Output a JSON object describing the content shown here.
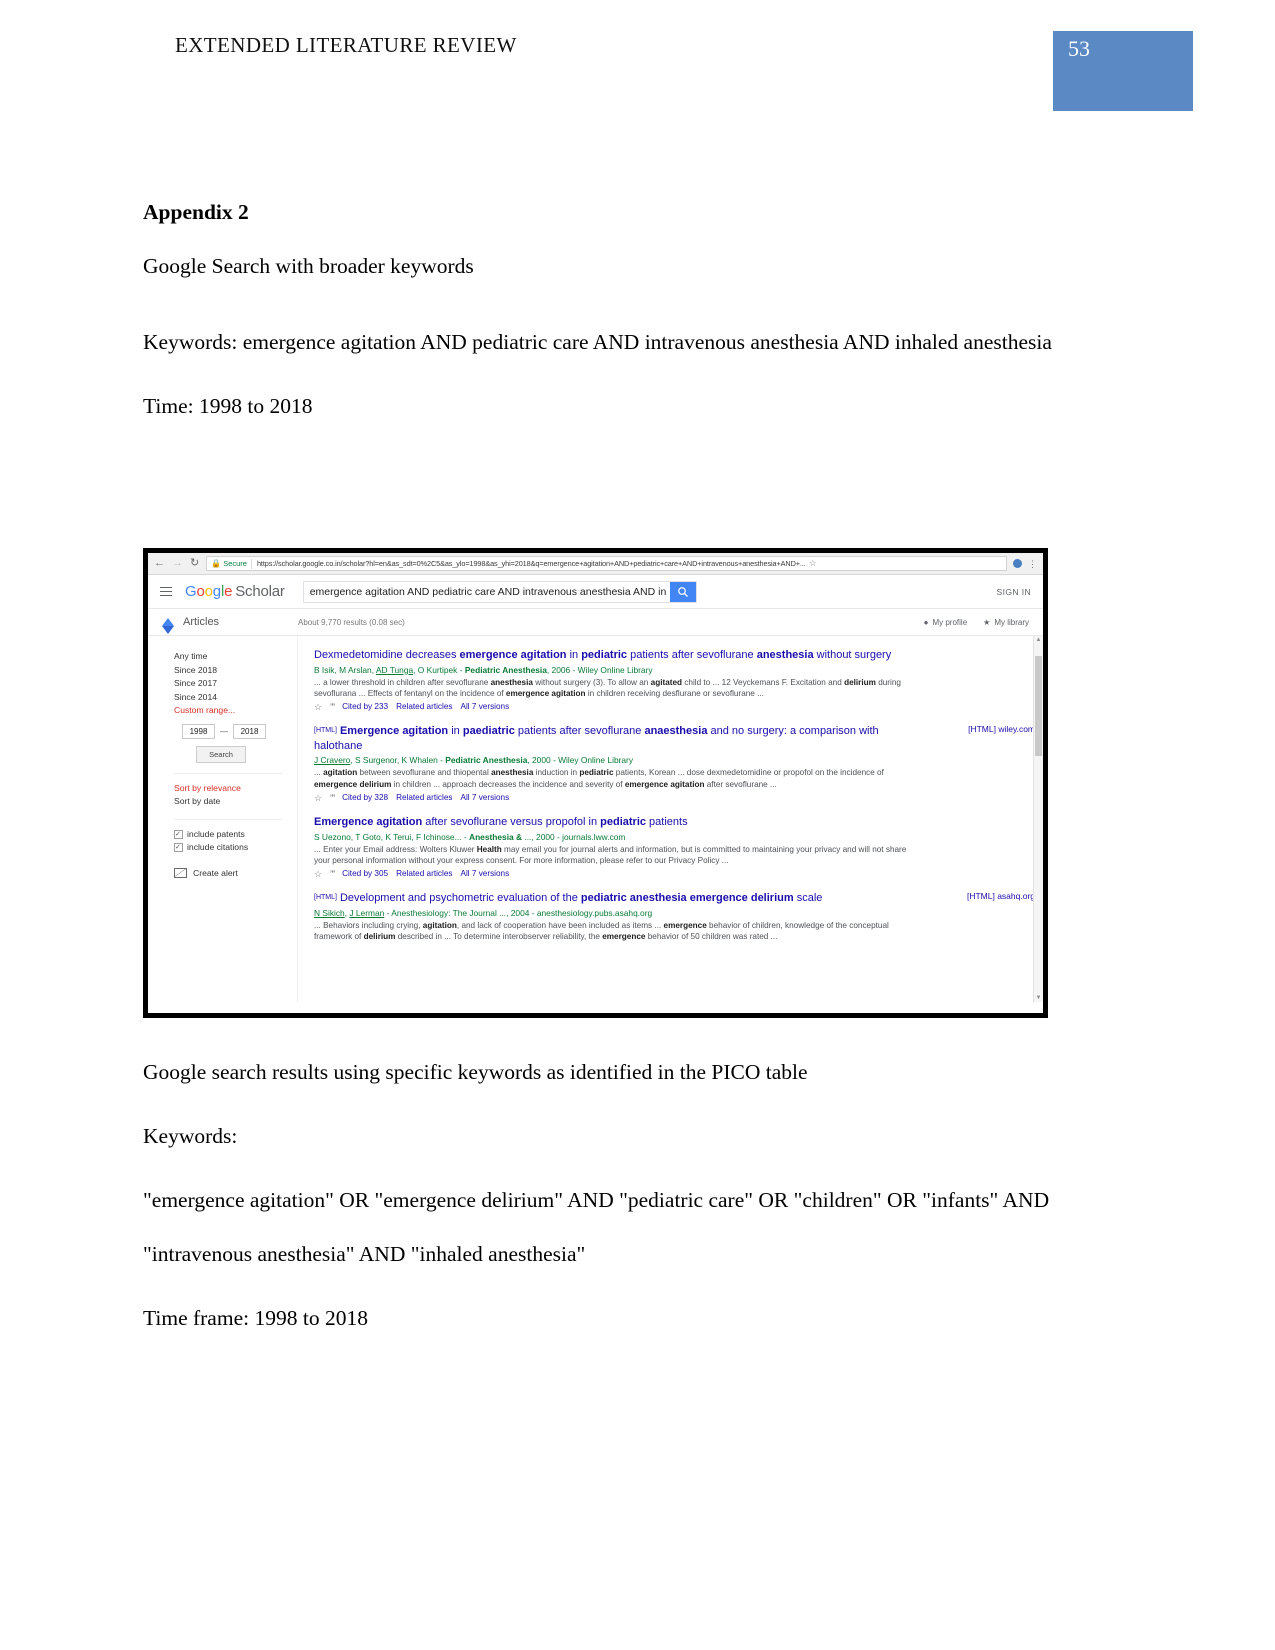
{
  "header": {
    "running_title": "EXTENDED LITERATURE REVIEW",
    "page_number": "53",
    "page_box_color": "#5b89c4"
  },
  "body_top": {
    "appendix_title": "Appendix 2",
    "subtitle": "Google Search with broader keywords",
    "keywords_line": "Keywords: emergence agitation AND pediatric care AND intravenous anesthesia AND inhaled anesthesia",
    "time_line": "Time: 1998 to 2018"
  },
  "body_bottom": {
    "caption": "Google search results using specific keywords as identified in the PICO table",
    "keywords_label": "Keywords:",
    "keywords_text": "\"emergence agitation\" OR \"emergence delirium\" AND \"pediatric care\" OR \"children\" OR \"infants\" AND \"intravenous anesthesia\" AND \"inhaled anesthesia\"",
    "time_frame": "Time frame: 1998 to 2018"
  },
  "screenshot": {
    "browser": {
      "secure_label": "Secure",
      "url": "https://scholar.google.co.in/scholar?hl=en&as_sdt=0%2C5&as_ylo=1998&as_yhi=2018&q=emergence+agitation+AND+pediatric+care+AND+intravenous+anesthesia+AND+...",
      "back_icon": "←",
      "forward_icon": "→",
      "reload_icon": "↻",
      "star_icon": "☆",
      "menu_icon": "⋮"
    },
    "scholar_header": {
      "logo_google": "Google",
      "logo_scholar": "Scholar",
      "search_value": "emergence agitation AND pediatric care AND intravenous anesthesia AND in",
      "sign_in": "SIGN IN"
    },
    "results_bar": {
      "articles_label": "Articles",
      "result_count": "About 9,770 results (0.08 sec)",
      "my_profile": "My profile",
      "my_library": "My library"
    },
    "sidebar": {
      "time_filters": [
        "Any time",
        "Since 2018",
        "Since 2017",
        "Since 2014"
      ],
      "custom_range": "Custom range...",
      "year_from": "1998",
      "year_to": "2018",
      "range_dash": "—",
      "search_button": "Search",
      "sort_options": [
        "Sort by relevance",
        "Sort by date"
      ],
      "checkboxes": [
        "include patents",
        "include citations"
      ],
      "create_alert": "Create alert"
    },
    "results": [
      {
        "title_html": "Dexmedetomidine decreases <b>emergence agitation</b> in <b>pediatric</b> patients after sevoflurane <b>anesthesia</b> without surgery",
        "tag": "",
        "authors_html": "B Isik, M Arslan, <u>AD Tunga</u>, O Kurtipek - <b>Pediatric Anesthesia</b>, 2006 - Wiley Online Library",
        "snippet_html": "... a lower threshold in children after sevoflurane <b>anesthesia</b> without surgery (3). To allow an <b>agitated</b> child to ... 12 Veyckemans F. Excitation and <b>delirium</b> during sevoflurana ... Effects of fentanyl on the incidence of <b>emergence agitation</b> in children receiving desflurane or sevoflurane ...",
        "cited_by": "Cited by 233",
        "related": "Related articles",
        "versions": "All 7 versions",
        "side_link": ""
      },
      {
        "title_html": "<b>Emergence agitation</b> in <b>paediatric</b> patients after sevoflurane <b>anaesthesia</b> and no surgery: a comparison with halothane",
        "tag": "[HTML]",
        "authors_html": "<u>J Cravero</u>, S Surgenor, K Whalen - <b>Pediatric Anesthesia</b>, 2000 - Wiley Online Library",
        "snippet_html": "... <b>agitation</b> between sevoflurane and thiopental <b>anesthesia</b> induction in <b>pediatric</b> patients, Korean ... dose dexmedetomidine or propofol on the incidence of <b>emergence delirium</b> in children ... approach decreases the incidence and severity of <b>emergence agitation</b> after sevoflurane ...",
        "cited_by": "Cited by 328",
        "related": "Related articles",
        "versions": "All 7 versions",
        "side_link": "[HTML] wiley.com"
      },
      {
        "title_html": "<b>Emergence agitation</b> after sevoflurane versus propofol in <b>pediatric</b> patients",
        "tag": "",
        "authors_html": "S Uezono, T Goto, K Terui, F Ichinose... - <b>Anesthesia &amp;</b> ..., 2000 - journals.lww.com",
        "snippet_html": "... Enter your Email address: Wolters Kluwer <b>Health</b> may email you for journal alerts and information, but is committed to maintaining your privacy and will not share your personal information without your express consent. For more information, please refer to our Privacy Policy ...",
        "cited_by": "Cited by 305",
        "related": "Related articles",
        "versions": "All 7 versions",
        "side_link": ""
      },
      {
        "title_html": "Development and psychometric evaluation of the <b>pediatric anesthesia emergence delirium</b> scale",
        "tag": "[HTML]",
        "authors_html": "<u>N Sikich</u>, <u>J Lerman</u> - Anesthesiology: The Journal ..., 2004 - anesthesiology.pubs.asahq.org",
        "snippet_html": "... Behaviors including crying, <b>agitation</b>, and lack of cooperation have been included as items ... <b>emergence</b> behavior of children, knowledge of the conceptual framework of <b>delirium</b> described in ... To determine interobserver reliability, the <b>emergence</b> behavior of 50 children was rated ...",
        "cited_by": "",
        "related": "",
        "versions": "",
        "side_link": "[HTML] asahq.org"
      }
    ]
  }
}
